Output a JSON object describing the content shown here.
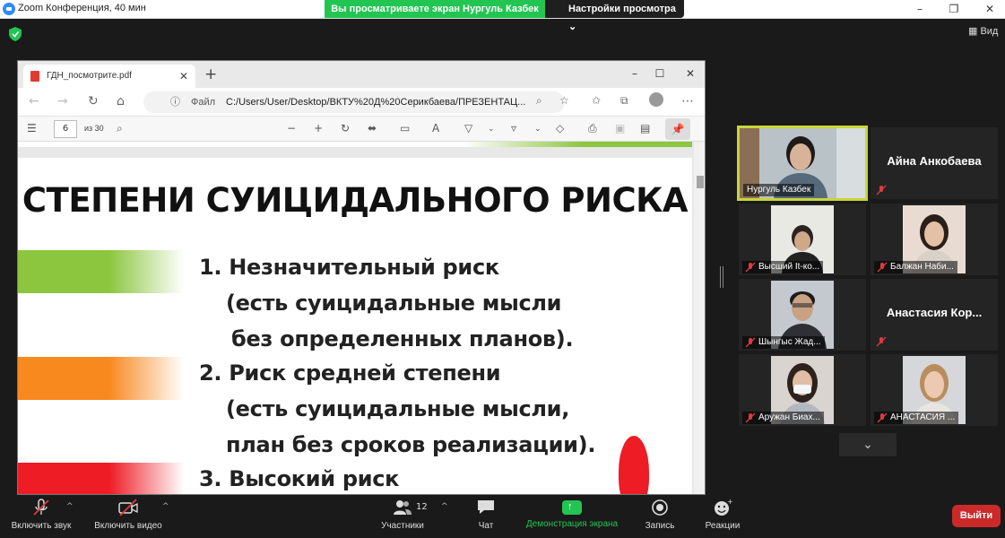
{
  "zoom": {
    "window_title": "Zoom Конференция, 40 мин",
    "share_banner": "Вы просматриваете экран Нургуль Казбек",
    "view_settings": "Настройки просмотра",
    "view_button": "Вид",
    "leave_button": "Выйти"
  },
  "browser": {
    "tab_title": "ГДН_посмотрите.pdf",
    "url_label": "Файл",
    "url": "C:/Users/User/Desktop/ВКТУ%20Д%20Серикбаева/ПРЕЗЕНТАЦ...",
    "page_number": "6",
    "page_total": "из 30"
  },
  "slide": {
    "title": "СТЕПЕНИ СУИЦИДАЛЬНОГО РИСКА",
    "lines": [
      "1. Незначительный риск",
      "(есть суицидальные мысли",
      "без определенных планов).",
      "2. Риск средней степени",
      "(есть суицидальные мысли,",
      "план без сроков реализации).",
      "3. Высокий риск"
    ],
    "colors": {
      "green": "#8cc63f",
      "orange": "#f7891f",
      "red": "#ee1c25"
    }
  },
  "gallery": {
    "participants": [
      {
        "name": "Нургуль Казбек",
        "video": true,
        "active_speaker": true
      },
      {
        "name": "Айна Анкобаева",
        "video": false
      },
      {
        "name": "Высший It-ко...",
        "video": true
      },
      {
        "name": "Балжан Наби...",
        "video": true
      },
      {
        "name": "Шынгыс Жад...",
        "video": true
      },
      {
        "name": "Анастасия  Кор...",
        "video": false
      },
      {
        "name": "Аружан Биах...",
        "video": true
      },
      {
        "name": "АНАСТАСИЯ ...",
        "video": true
      }
    ],
    "speaker_border_color": "#c6d63a"
  },
  "toolbar": {
    "unmute": "Включить звук",
    "start_video": "Включить видео",
    "participants": "Участники",
    "participants_count": "12",
    "chat": "Чат",
    "share_screen": "Демонстрация экрана",
    "record": "Запись",
    "reactions": "Реакции"
  }
}
